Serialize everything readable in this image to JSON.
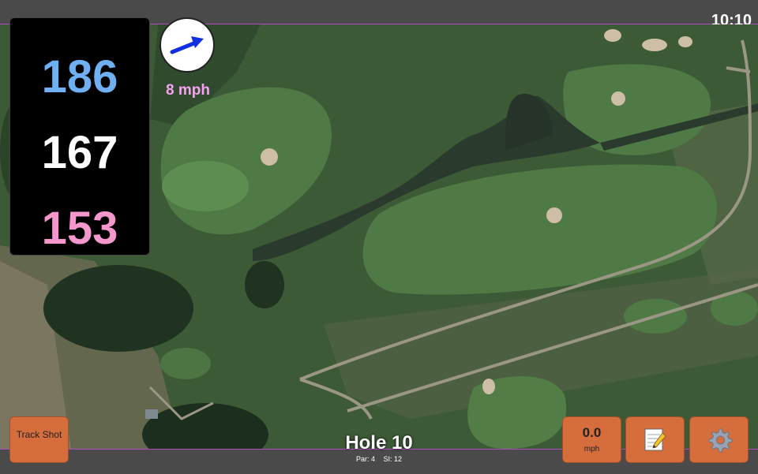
{
  "status": {
    "time": "10:10"
  },
  "distances": {
    "back": "186",
    "center": "167",
    "front": "153"
  },
  "wind": {
    "speed_label": "8 mph",
    "icon": "wind-arrow-icon"
  },
  "hole": {
    "title": "Hole 10",
    "par": "Par: 4",
    "stroke_index": "SI: 12"
  },
  "buttons": {
    "track_shot": "Track Shot",
    "speed_value": "0.0",
    "speed_unit": "mph",
    "notes_icon": "notepad-icon",
    "settings_icon": "gear-icon"
  },
  "colors": {
    "back": "#6fb0f3",
    "center": "#ffffff",
    "front": "#f596cc",
    "wind_text": "#f7a2f0",
    "button": "#d56e3c",
    "accent_line": "#b04cc0"
  }
}
